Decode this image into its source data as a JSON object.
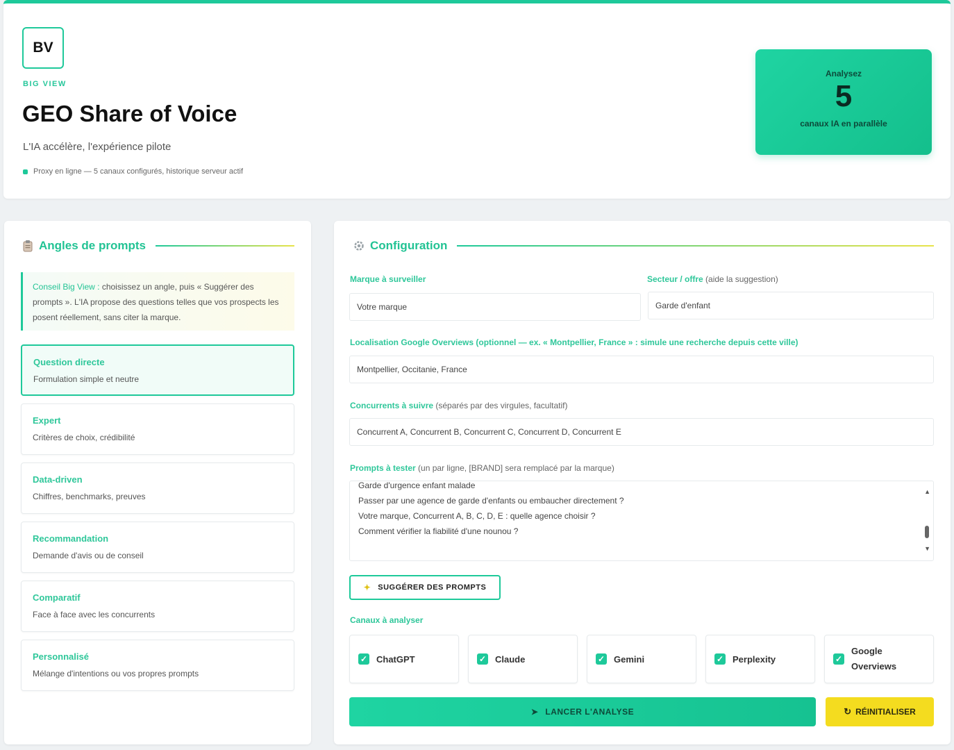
{
  "header": {
    "logo": "BV",
    "brand": "BIG VIEW",
    "title": "GEO Share of Voice",
    "subtitle": "L'IA accélère, l'expérience pilote",
    "status": "Proxy en ligne — 5 canaux configurés, historique serveur actif",
    "stat": {
      "label": "Analysez",
      "value": "5",
      "sub": "canaux IA en parallèle"
    }
  },
  "angles_panel": {
    "icon": "clipboard-icon",
    "title": "Angles de prompts",
    "tip_strong": "Conseil Big View :",
    "tip_text": " choisissez un angle, puis « Suggérer des prompts ». L'IA propose des questions telles que vos prospects les posent réellement, sans citer la marque.",
    "items": [
      {
        "name": "Question directe",
        "desc": "Formulation simple et neutre",
        "active": true
      },
      {
        "name": "Expert",
        "desc": "Critères de choix, crédibilité"
      },
      {
        "name": "Data-driven",
        "desc": "Chiffres, benchmarks, preuves"
      },
      {
        "name": "Recommandation",
        "desc": "Demande d'avis ou de conseil"
      },
      {
        "name": "Comparatif",
        "desc": "Face à face avec les concurrents"
      },
      {
        "name": "Personnalisé",
        "desc": "Mélange d'intentions ou vos propres prompts"
      }
    ]
  },
  "config": {
    "icon": "gear-icon",
    "title": "Configuration",
    "brand_label": "Marque à surveiller",
    "brand_value": "Votre marque",
    "sector_label": "Secteur / offre",
    "sector_hint": " (aide la suggestion)",
    "sector_value": "Garde d'enfant",
    "location_label": "Localisation Google Overviews (optionnel — ex. « Montpellier, France » : simule une recherche depuis cette ville)",
    "location_value": "Montpellier, Occitanie, France",
    "competitors_label": "Concurrents à suivre",
    "competitors_hint": " (séparés par des virgules, facultatif)",
    "competitors_value": "Concurrent A, Concurrent B, Concurrent C, Concurrent D, Concurrent E",
    "prompts_label": "Prompts à tester",
    "prompts_hint": " (un par ligne, [BRAND] sera remplacé par la marque)",
    "prompts": [
      "Garde d'urgence enfant malade",
      "Passer par une agence de garde d'enfants ou embaucher directement ?",
      "Votre marque, Concurrent A, B, C, D, E : quelle agence choisir ?",
      "Comment vérifier la fiabilité d'une nounou ?"
    ],
    "suggest_button": "SUGGÉRER DES PROMPTS",
    "channels_label": "Canaux à analyser",
    "channels": [
      "ChatGPT",
      "Claude",
      "Gemini",
      "Perplexity",
      "Google Overviews"
    ],
    "launch_button": "LANCER L'ANALYSE",
    "reset_button": "RÉINITIALISER"
  }
}
